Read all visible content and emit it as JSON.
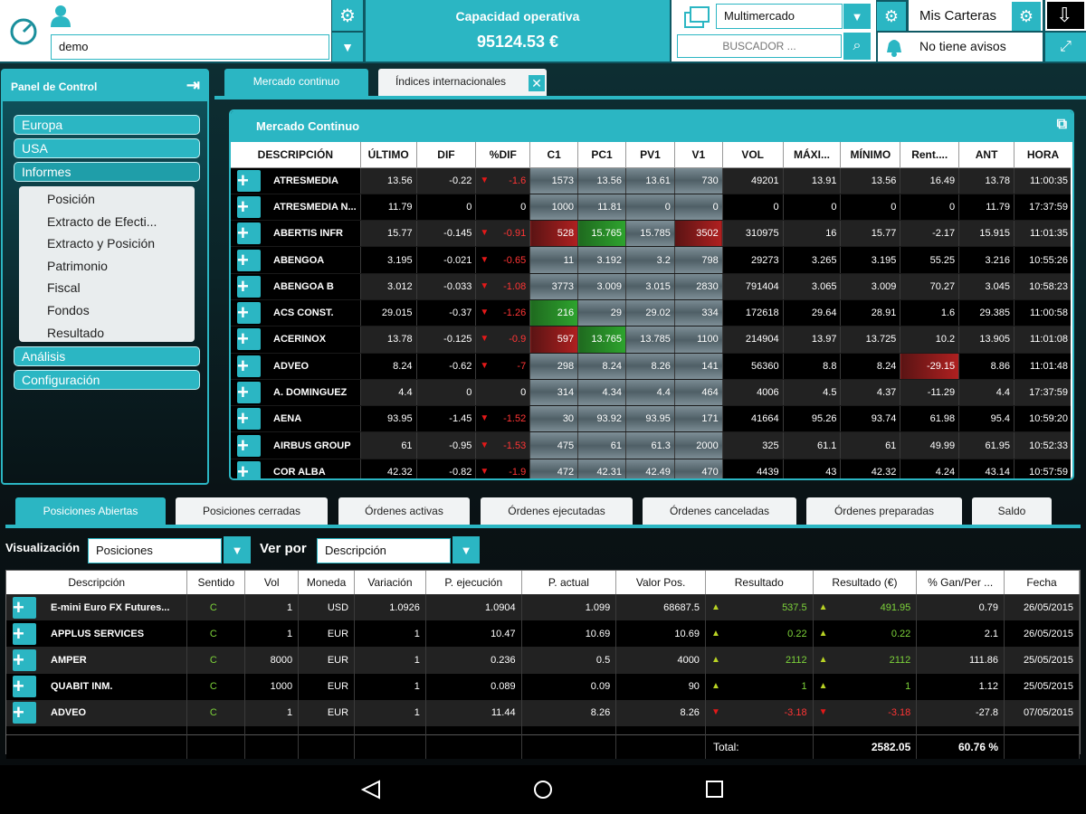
{
  "header": {
    "user_field": "demo",
    "cap_title": "Capacidad operativa",
    "cap_value": "95124.53  €",
    "market_select": "Multimercado",
    "search_placeholder": "BUSCADOR ...",
    "carteras": "Mis Carteras",
    "avisos": "No tiene avisos"
  },
  "panel": {
    "title": "Panel de Control",
    "items": [
      "Europa",
      "USA",
      "Informes",
      "Análisis",
      "Configuración"
    ],
    "sub": [
      "Posición",
      "Extracto de Efecti...",
      "Extracto y Posición",
      "Patrimonio",
      "Fiscal",
      "Fondos",
      "Resultado"
    ]
  },
  "tabs": [
    "Mercado continuo",
    "Índices internacionales"
  ],
  "market": {
    "title": "Mercado Continuo",
    "columns": [
      "DESCRIPCIÓN",
      "ÚLTIMO",
      "DIF",
      "%DIF",
      "C1",
      "PC1",
      "PV1",
      "V1",
      "VOL",
      "MÁXI...",
      "MÍNIMO",
      "Rent....",
      "ANT",
      "HORA"
    ],
    "rows": [
      [
        "ATRESMEDIA",
        "13.56",
        "-0.22",
        "-1.6",
        "1573",
        "13.56",
        "13.61",
        "730",
        "49201",
        "13.91",
        "13.56",
        "16.49",
        "13.78",
        "11:00:35"
      ],
      [
        "ATRESMEDIA N...",
        "11.79",
        "0",
        "0",
        "1000",
        "11.81",
        "0",
        "0",
        "0",
        "0",
        "0",
        "0",
        "11.79",
        "17:37:59"
      ],
      [
        "ABERTIS INFR",
        "15.77",
        "-0.145",
        "-0.91",
        "528",
        "15.765",
        "15.785",
        "3502",
        "310975",
        "16",
        "15.77",
        "-2.17",
        "15.915",
        "11:01:35"
      ],
      [
        "ABENGOA",
        "3.195",
        "-0.021",
        "-0.65",
        "11",
        "3.192",
        "3.2",
        "798",
        "29273",
        "3.265",
        "3.195",
        "55.25",
        "3.216",
        "10:55:26"
      ],
      [
        "ABENGOA B",
        "3.012",
        "-0.033",
        "-1.08",
        "3773",
        "3.009",
        "3.015",
        "2830",
        "791404",
        "3.065",
        "3.009",
        "70.27",
        "3.045",
        "10:58:23"
      ],
      [
        "ACS CONST.",
        "29.015",
        "-0.37",
        "-1.26",
        "216",
        "29",
        "29.02",
        "334",
        "172618",
        "29.64",
        "28.91",
        "1.6",
        "29.385",
        "11:00:58"
      ],
      [
        "ACERINOX",
        "13.78",
        "-0.125",
        "-0.9",
        "597",
        "13.765",
        "13.785",
        "1100",
        "214904",
        "13.97",
        "13.725",
        "10.2",
        "13.905",
        "11:01:08"
      ],
      [
        "ADVEO",
        "8.24",
        "-0.62",
        "-7",
        "298",
        "8.24",
        "8.26",
        "141",
        "56360",
        "8.8",
        "8.24",
        "-29.15",
        "8.86",
        "11:01:48"
      ],
      [
        "A. DOMINGUEZ",
        "4.4",
        "0",
        "0",
        "314",
        "4.34",
        "4.4",
        "464",
        "4006",
        "4.5",
        "4.37",
        "-11.29",
        "4.4",
        "17:37:59"
      ],
      [
        "AENA",
        "93.95",
        "-1.45",
        "-1.52",
        "30",
        "93.92",
        "93.95",
        "171",
        "41664",
        "95.26",
        "93.74",
        "61.98",
        "95.4",
        "10:59:20"
      ],
      [
        "AIRBUS GROUP",
        "61",
        "-0.95",
        "-1.53",
        "475",
        "61",
        "61.3",
        "2000",
        "325",
        "61.1",
        "61",
        "49.99",
        "61.95",
        "10:52:33"
      ],
      [
        "COR ALBA",
        "42.32",
        "-0.82",
        "-1.9",
        "472",
        "42.31",
        "42.49",
        "470",
        "4439",
        "43",
        "42.32",
        "4.24",
        "43.14",
        "10:57:59"
      ]
    ]
  },
  "bottom_tabs": [
    "Posiciones Abiertas",
    "Posiciones cerradas",
    "Órdenes activas",
    "Órdenes ejecutadas",
    "Órdenes canceladas",
    "Órdenes preparadas",
    "Saldo"
  ],
  "filters": {
    "vis_label": "Visualización",
    "vis_value": "Posiciones",
    "ver_label": "Ver por",
    "ver_value": "Descripción"
  },
  "positions": {
    "columns": [
      "Descripción",
      "Sentido",
      "Vol",
      "Moneda",
      "Variación",
      "P. ejecución",
      "P. actual",
      "Valor Pos.",
      "Resultado",
      "Resultado (€)",
      "% Gan/Per ...",
      "Fecha"
    ],
    "rows": [
      [
        "E-mini Euro FX Futures...",
        "C",
        "1",
        "USD",
        "1.0926",
        "1.0904",
        "1.099",
        "68687.5",
        "537.5",
        "491.95",
        "0.79",
        "26/05/2015"
      ],
      [
        "APPLUS SERVICES",
        "C",
        "1",
        "EUR",
        "1",
        "10.47",
        "10.69",
        "10.69",
        "0.22",
        "0.22",
        "2.1",
        "26/05/2015"
      ],
      [
        "AMPER",
        "C",
        "8000",
        "EUR",
        "1",
        "0.236",
        "0.5",
        "4000",
        "2112",
        "2112",
        "111.86",
        "25/05/2015"
      ],
      [
        "QUABIT INM.",
        "C",
        "1000",
        "EUR",
        "1",
        "0.089",
        "0.09",
        "90",
        "1",
        "1",
        "1.12",
        "25/05/2015"
      ],
      [
        "ADVEO",
        "C",
        "1",
        "EUR",
        "1",
        "11.44",
        "8.26",
        "8.26",
        "-3.18",
        "-3.18",
        "-27.8",
        "07/05/2015"
      ]
    ],
    "total_label": "Total:",
    "total_value": "2582.05",
    "total_pct": "60.76 %"
  },
  "colors": {
    "accent": "#2bb6c3",
    "up": "#7dd33a",
    "down": "#ff3535"
  }
}
